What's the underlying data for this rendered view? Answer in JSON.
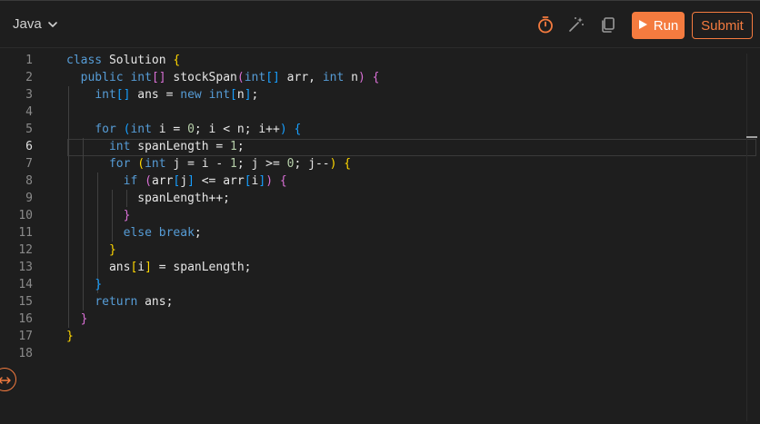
{
  "toolbar": {
    "language": "Java",
    "run_label": "Run",
    "submit_label": "Submit",
    "icons": [
      "language-chevron-down-icon",
      "timer-icon",
      "magic-wand-icon",
      "copy-icon",
      "play-icon"
    ]
  },
  "colors": {
    "accent": "#f47b3f",
    "background": "#1e1e1e",
    "keyword": "#569cd6",
    "bracket_level1": "#ffd700",
    "bracket_level2": "#da70d6",
    "bracket_level3": "#179fff"
  },
  "editor": {
    "active_line": 6,
    "line_numbers": [
      "1",
      "2",
      "3",
      "4",
      "5",
      "6",
      "7",
      "8",
      "9",
      "10",
      "11",
      "12",
      "13",
      "14",
      "15",
      "16",
      "17",
      "18"
    ],
    "lines": [
      [
        [
          "kw",
          "class"
        ],
        [
          "t",
          " Solution "
        ],
        [
          "b1",
          "{"
        ]
      ],
      [
        [
          "t",
          "  "
        ],
        [
          "kw",
          "public"
        ],
        [
          "t",
          " "
        ],
        [
          "kw",
          "int"
        ],
        [
          "b2",
          "[]"
        ],
        [
          "t",
          " stockSpan"
        ],
        [
          "b2",
          "("
        ],
        [
          "kw",
          "int"
        ],
        [
          "b3",
          "[]"
        ],
        [
          "t",
          " arr, "
        ],
        [
          "kw",
          "int"
        ],
        [
          "t",
          " n"
        ],
        [
          "b2",
          ")"
        ],
        [
          "t",
          " "
        ],
        [
          "b2",
          "{"
        ]
      ],
      [
        [
          "t",
          "    "
        ],
        [
          "kw",
          "int"
        ],
        [
          "b3",
          "[]"
        ],
        [
          "t",
          " ans = "
        ],
        [
          "kw",
          "new"
        ],
        [
          "t",
          " "
        ],
        [
          "kw",
          "int"
        ],
        [
          "b3",
          "["
        ],
        [
          "t",
          "n"
        ],
        [
          "b3",
          "]"
        ],
        [
          "t",
          ";"
        ]
      ],
      [],
      [
        [
          "t",
          "    "
        ],
        [
          "kw",
          "for"
        ],
        [
          "t",
          " "
        ],
        [
          "b3",
          "("
        ],
        [
          "kw",
          "int"
        ],
        [
          "t",
          " i = "
        ],
        [
          "num",
          "0"
        ],
        [
          "t",
          "; i < n; i++"
        ],
        [
          "b3",
          ")"
        ],
        [
          "t",
          " "
        ],
        [
          "b3",
          "{"
        ]
      ],
      [
        [
          "t",
          "      "
        ],
        [
          "kw",
          "int"
        ],
        [
          "t",
          " spanLength = "
        ],
        [
          "num",
          "1"
        ],
        [
          "t",
          ";"
        ]
      ],
      [
        [
          "t",
          "      "
        ],
        [
          "kw",
          "for"
        ],
        [
          "t",
          " "
        ],
        [
          "b1",
          "("
        ],
        [
          "kw",
          "int"
        ],
        [
          "t",
          " j = i - "
        ],
        [
          "num",
          "1"
        ],
        [
          "t",
          "; j >= "
        ],
        [
          "num",
          "0"
        ],
        [
          "t",
          "; j--"
        ],
        [
          "b1",
          ")"
        ],
        [
          "t",
          " "
        ],
        [
          "b1",
          "{"
        ]
      ],
      [
        [
          "t",
          "        "
        ],
        [
          "kw",
          "if"
        ],
        [
          "t",
          " "
        ],
        [
          "b2",
          "("
        ],
        [
          "t",
          "arr"
        ],
        [
          "b3",
          "["
        ],
        [
          "t",
          "j"
        ],
        [
          "b3",
          "]"
        ],
        [
          "t",
          " <= arr"
        ],
        [
          "b3",
          "["
        ],
        [
          "t",
          "i"
        ],
        [
          "b3",
          "]"
        ],
        [
          "b2",
          ")"
        ],
        [
          "t",
          " "
        ],
        [
          "b2",
          "{"
        ]
      ],
      [
        [
          "t",
          "          spanLength++;"
        ]
      ],
      [
        [
          "t",
          "        "
        ],
        [
          "b2",
          "}"
        ]
      ],
      [
        [
          "t",
          "        "
        ],
        [
          "kw",
          "else"
        ],
        [
          "t",
          " "
        ],
        [
          "kw",
          "break"
        ],
        [
          "t",
          ";"
        ]
      ],
      [
        [
          "t",
          "      "
        ],
        [
          "b1",
          "}"
        ]
      ],
      [
        [
          "t",
          "      ans"
        ],
        [
          "b1",
          "["
        ],
        [
          "t",
          "i"
        ],
        [
          "b1",
          "]"
        ],
        [
          "t",
          " = spanLength;"
        ]
      ],
      [
        [
          "t",
          "    "
        ],
        [
          "b3",
          "}"
        ]
      ],
      [
        [
          "t",
          "    "
        ],
        [
          "kw",
          "return"
        ],
        [
          "t",
          " ans;"
        ]
      ],
      [
        [
          "t",
          "  "
        ],
        [
          "b2",
          "}"
        ]
      ],
      [
        [
          "b1",
          "}"
        ]
      ],
      []
    ]
  }
}
